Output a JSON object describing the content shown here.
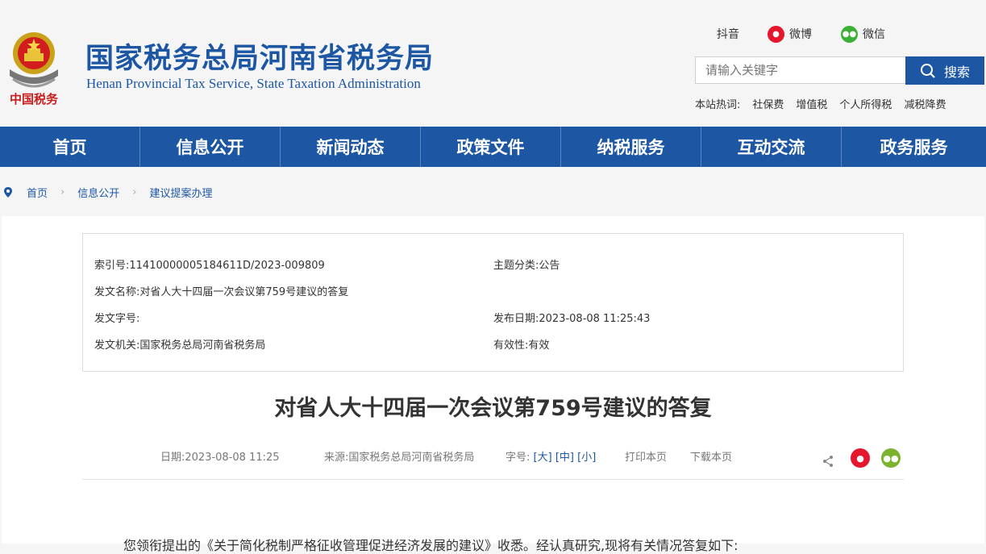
{
  "site": {
    "title_cn": "国家税务总局河南省税务局",
    "title_en": "Henan Provincial Tax Service, State Taxation Administration",
    "emblem_text": "中国税务"
  },
  "social": {
    "douyin": "抖音",
    "weibo": "微博",
    "weixin": "微信"
  },
  "search": {
    "placeholder": "请输入关键字",
    "button": "搜索"
  },
  "hot": {
    "label": "本站热词:",
    "items": [
      "社保费",
      "增值税",
      "个人所得税",
      "减税降费"
    ]
  },
  "nav": [
    "首页",
    "信息公开",
    "新闻动态",
    "政策文件",
    "纳税服务",
    "互动交流",
    "政务服务"
  ],
  "breadcrumb": [
    "首页",
    "信息公开",
    "建议提案办理"
  ],
  "meta": {
    "index_no": "索引号:11410000005184611D/2023-009809",
    "subject": "主题分类:公告",
    "doc_name": "发文名称:对省人大十四届一次会议第759号建议的答复",
    "doc_no": "发文字号:",
    "publish_date": "发布日期:2023-08-08 11:25:43",
    "issuer": "发文机关:国家税务总局河南省税务局",
    "validity": "有效性:有效"
  },
  "article": {
    "title": "对省人大十四届一次会议第759号建议的答复",
    "date": "日期:2023-08-08 11:25",
    "source": "来源:国家税务总局河南省税务局",
    "font_label": "字号:",
    "font_large": "[大]",
    "font_medium": "[中]",
    "font_small": "[小]",
    "print": "打印本页",
    "download": "下载本页",
    "body_start": "您领衔提出的《关于简化税制严格征收管理促进经济发展的建议》收悉。经认真研究,现将有关情况答复如下:"
  },
  "colors": {
    "brand": "#1d57a4",
    "weibo": "#e6162d",
    "weixin": "#4caf50"
  }
}
